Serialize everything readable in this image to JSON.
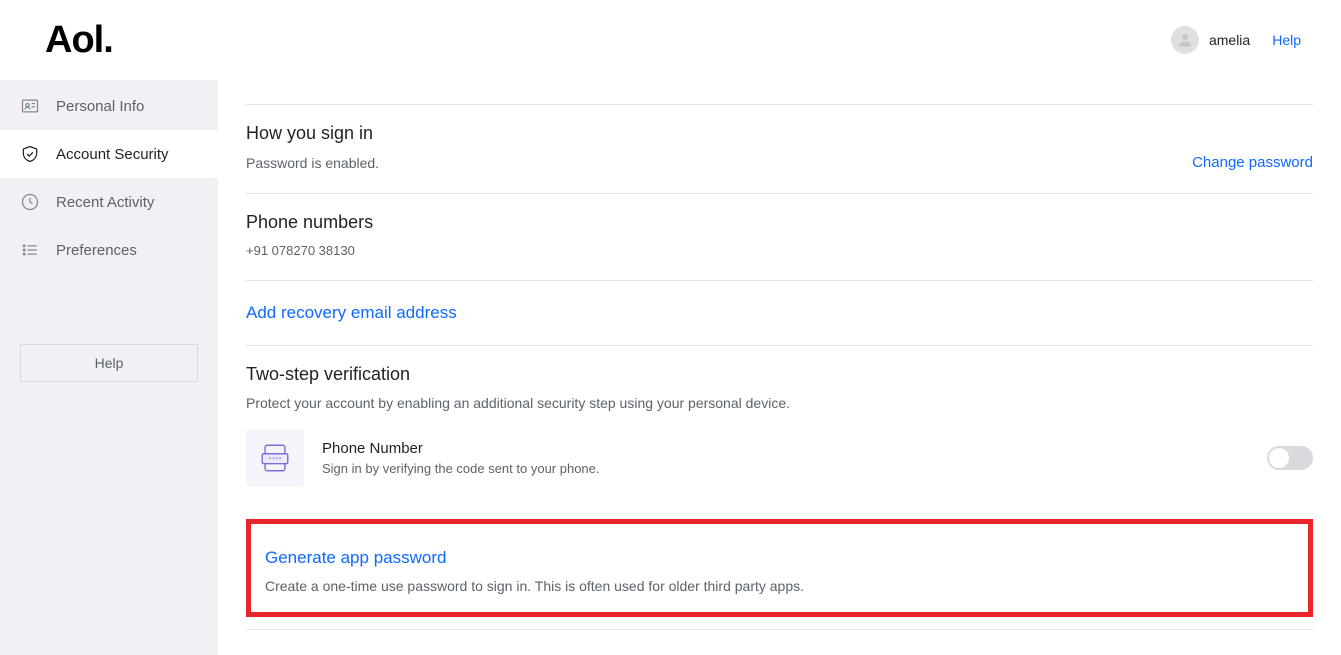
{
  "header": {
    "logo": "Aol.",
    "username": "amelia",
    "help": "Help"
  },
  "sidebar": {
    "items": [
      {
        "label": "Personal Info"
      },
      {
        "label": "Account Security"
      },
      {
        "label": "Recent Activity"
      },
      {
        "label": "Preferences"
      }
    ],
    "help_button": "Help"
  },
  "sections": {
    "signin": {
      "title": "How you sign in",
      "status": "Password is enabled.",
      "change_link": "Change password"
    },
    "phone": {
      "title": "Phone numbers",
      "number": "+91 078270 38130"
    },
    "recovery": {
      "link": "Add recovery email address"
    },
    "tsv": {
      "title": "Two-step verification",
      "desc": "Protect your account by enabling an additional security step using your personal device.",
      "method_label": "Phone Number",
      "method_desc": "Sign in by verifying the code sent to your phone."
    },
    "gen": {
      "title": "Generate app password",
      "desc": "Create a one-time use password to sign in. This is often used for older third party apps."
    }
  }
}
